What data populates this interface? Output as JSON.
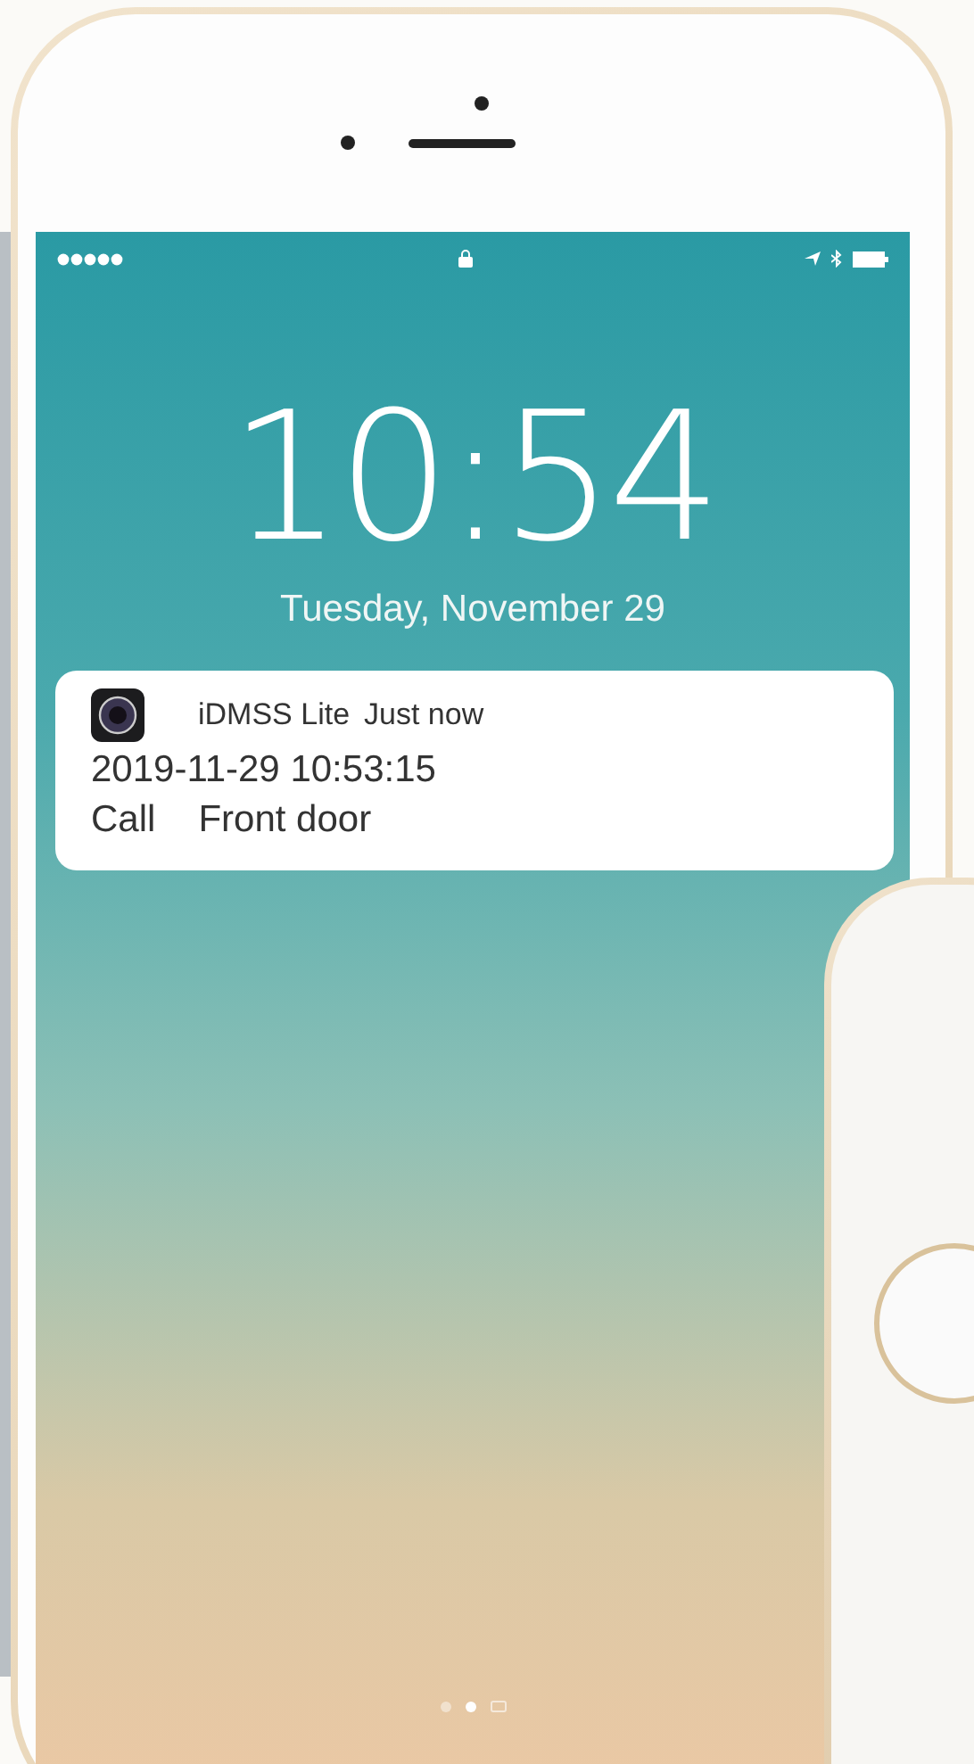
{
  "lock_screen": {
    "time": "10:54",
    "date": "Tuesday, November 29"
  },
  "notification": {
    "app_name": "iDMSS Lite",
    "timestamp": "Just now",
    "datetime": "2019-11-29 10:53:15",
    "event": "Call",
    "location": "Front door"
  },
  "page_dots": [
    {
      "kind": "dot",
      "selected": false
    },
    {
      "kind": "dot",
      "selected": true
    },
    {
      "kind": "camera",
      "selected": false
    }
  ]
}
